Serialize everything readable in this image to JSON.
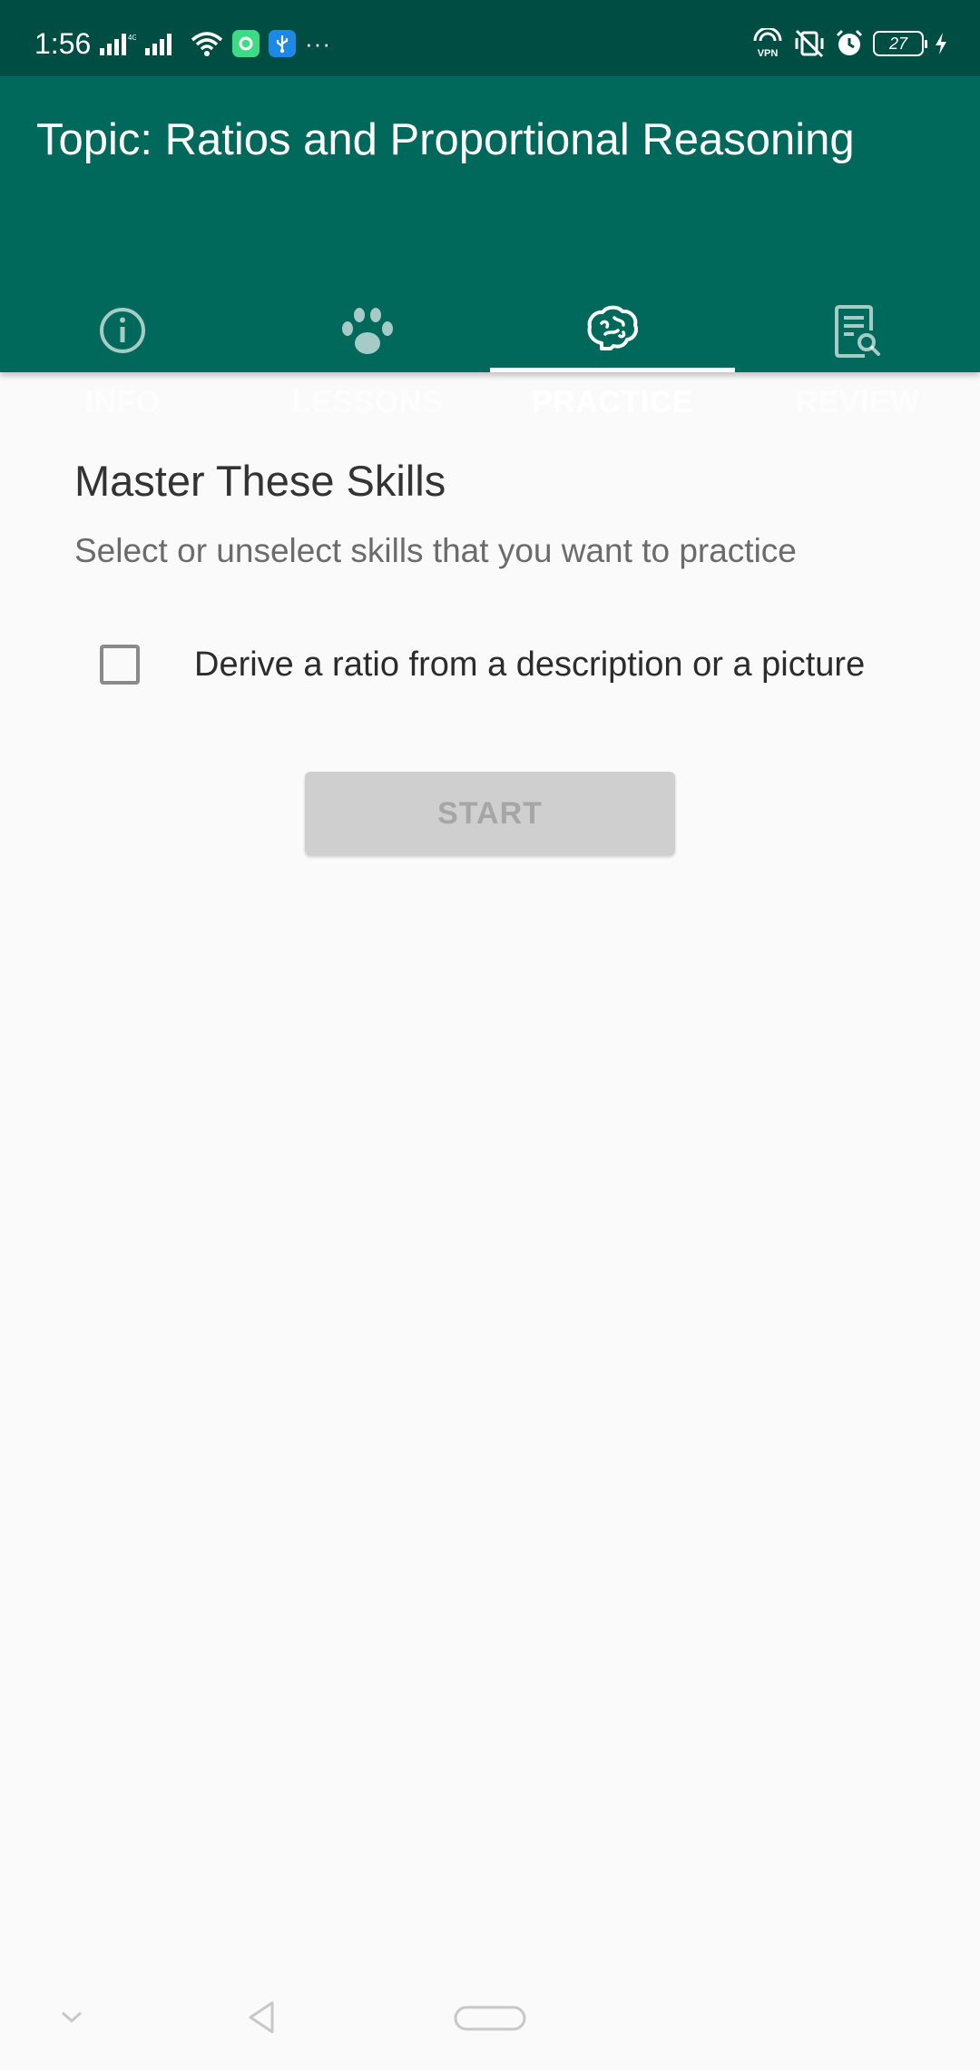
{
  "status_bar": {
    "time": "1:56",
    "left_icons": [
      "signal-icon",
      "signal-icon",
      "wifi-icon",
      "app-notification-icon",
      "usb-icon",
      "more-icon"
    ],
    "more": "···",
    "right_icons": [
      "vpn-icon",
      "vibrate-off-icon",
      "alarm-icon",
      "battery-icon",
      "charging-icon"
    ],
    "vpn_label": "VPN",
    "battery_level": "27"
  },
  "app_bar": {
    "title": "Topic: Ratios and Proportional Reasoning",
    "background_color": "#00695c"
  },
  "tabs": [
    {
      "label": "INFO",
      "icon": "info-icon",
      "active": false
    },
    {
      "label": "LESSONS",
      "icon": "paw-icon",
      "active": false
    },
    {
      "label": "PRACTICE",
      "icon": "brain-icon",
      "active": true
    },
    {
      "label": "REVIEW",
      "icon": "review-document-icon",
      "active": false
    }
  ],
  "main": {
    "title": "Master These Skills",
    "subtitle": "Select or unselect skills that you want to practice",
    "skills": [
      {
        "label": "Derive a ratio from a description or a picture",
        "checked": false
      }
    ],
    "start_label": "START",
    "start_enabled": false
  },
  "nav_bar": {
    "icons": [
      "collapse-chevron-icon",
      "back-icon",
      "home-pill-icon"
    ]
  }
}
